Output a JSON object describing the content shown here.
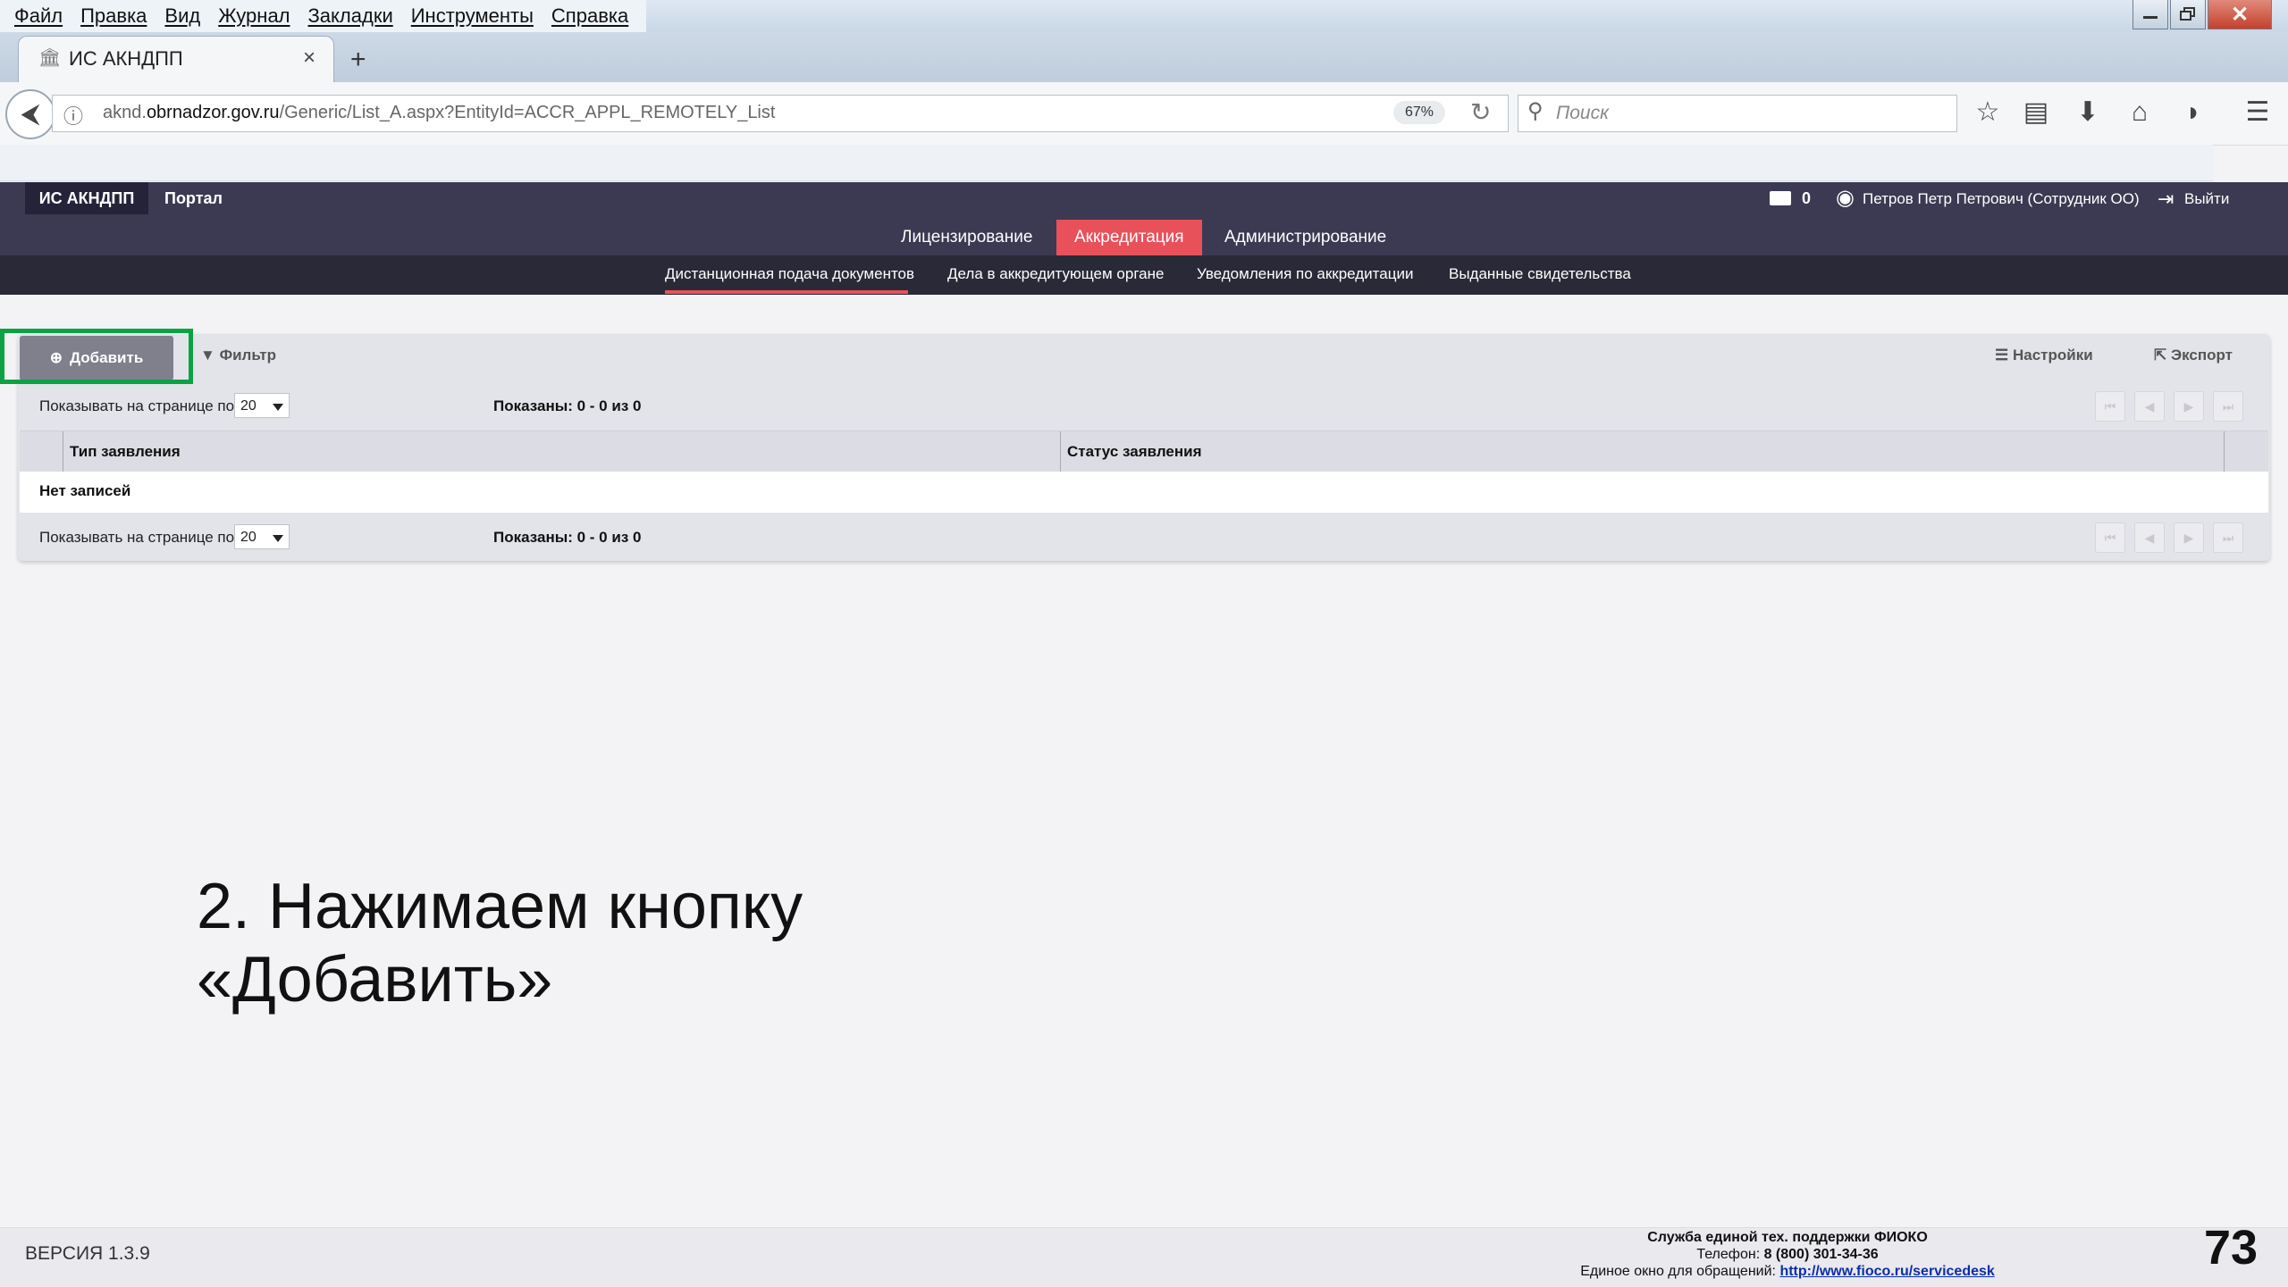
{
  "browser": {
    "menu": [
      "Файл",
      "Правка",
      "Вид",
      "Журнал",
      "Закладки",
      "Инструменты",
      "Справка"
    ],
    "tab_title": "ИС АКНДПП",
    "url_prefix": "aknd.",
    "url_domain": "obrnadzor.gov.ru",
    "url_path": "/Generic/List_A.aspx?EntityId=ACCR_APPL_REMOTELY_List",
    "zoom": "67%",
    "search_placeholder": "Поиск"
  },
  "app": {
    "brand": "ИС АКНДПП",
    "portal": "Портал",
    "mail_count": "0",
    "user": "Петров Петр Петрович (Сотрудник ОО)",
    "logout": "Выйти",
    "main_nav": [
      "Лицензирование",
      "Аккредитация",
      "Администрирование"
    ],
    "main_nav_active": "Аккредитация",
    "sub_nav": [
      "Дистанционная подача документов",
      "Дела в аккредитующем органе",
      "Уведомления по аккредитации",
      "Выданные свидетельства"
    ],
    "sub_nav_active": "Дистанционная подача документов"
  },
  "toolbar": {
    "add": "Добавить",
    "filter": "Фильтр",
    "settings": "Настройки",
    "export": "Экспорт"
  },
  "pager": {
    "label": "Показывать на странице по",
    "page_size": "20",
    "shown": "Показаны: 0 - 0 из 0"
  },
  "table": {
    "columns": [
      "Тип заявления",
      "Статус заявления"
    ],
    "empty": "Нет записей"
  },
  "instruction": {
    "line1": "2. Нажимаем кнопку",
    "line2": "«Добавить»"
  },
  "footer": {
    "version": "ВЕРСИЯ 1.3.9",
    "support_title": "Служба единой тех. поддержки ФИОКО",
    "phone_label": "Телефон: ",
    "phone": "8 (800) 301-34-36",
    "window_label": "Единое окно для обращений: ",
    "link": "http://www.fioco.ru/servicedesk"
  },
  "slide_number": "73",
  "colors": {
    "header_bg": "#3b3a52",
    "accent": "#e8515a",
    "highlight": "#0ba243"
  }
}
